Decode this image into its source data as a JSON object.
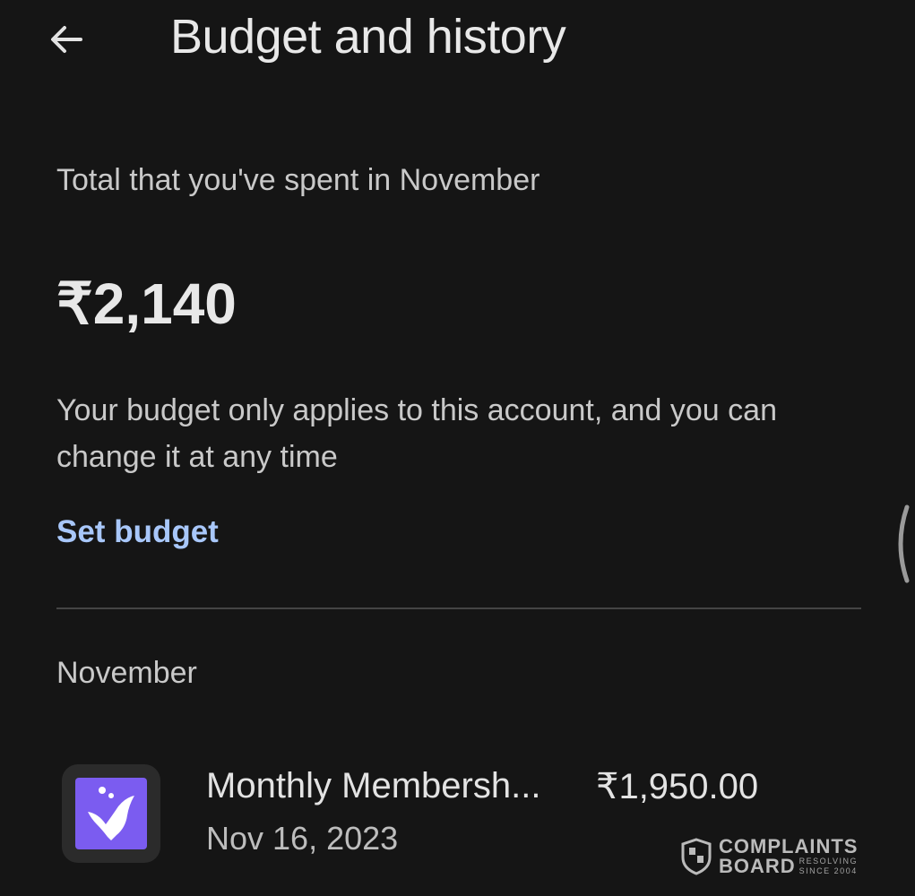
{
  "header": {
    "back_icon": "arrow-left-icon",
    "title": "Budget and history"
  },
  "summary": {
    "spent_label": "Total that you've spent in November",
    "spent_amount": "₹2,140",
    "budget_note": "Your budget only applies to this account, and you can change it at any time",
    "set_budget_label": "Set budget"
  },
  "history": {
    "month": "November",
    "transactions": [
      {
        "icon": "whale-tail-app-icon",
        "name": "Monthly Membersh...",
        "date": "Nov 16, 2023",
        "amount": "₹1,950.00"
      }
    ]
  },
  "watermark": {
    "line1": "COMPLAINTS",
    "line2": "BOARD",
    "sub1": "RESOLVING",
    "sub2": "SINCE 2004"
  },
  "colors": {
    "background": "#151515",
    "link": "#a8c7fa",
    "app_icon": "#7b5cf0"
  }
}
